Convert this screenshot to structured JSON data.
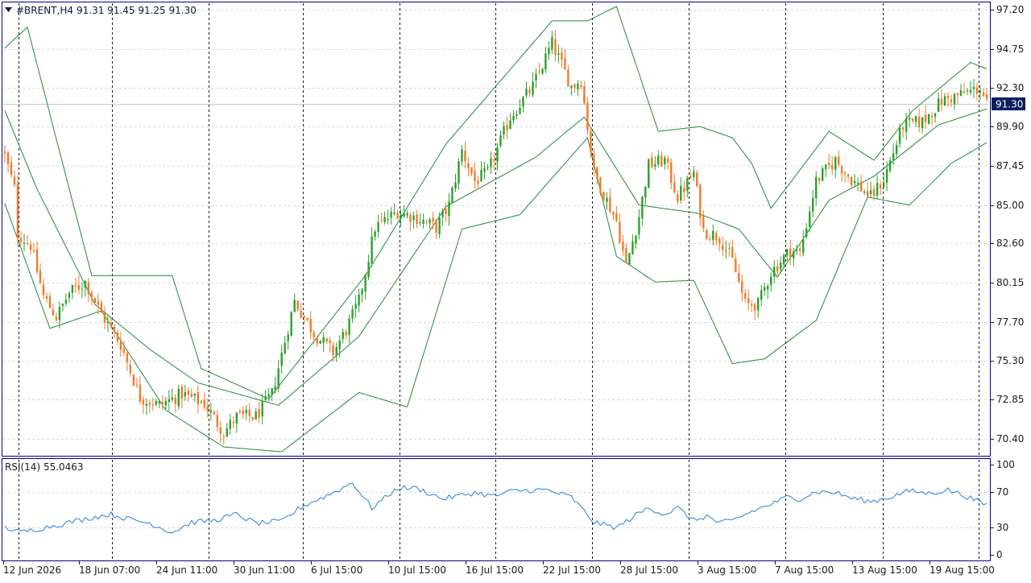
{
  "header": {
    "symbol": "#BRENT,H4",
    "ohlc": "91.31 91.45 91.25 91.30",
    "dropdown_icon": "triangle-down-icon"
  },
  "price_panel": {
    "current_price": "91.30",
    "y_ticks": [
      "97.20",
      "94.75",
      "92.30",
      "89.90",
      "87.45",
      "85.00",
      "82.60",
      "80.15",
      "77.70",
      "75.30",
      "72.85",
      "70.40"
    ],
    "y_range": [
      69.4,
      97.6
    ]
  },
  "rsi_panel": {
    "label": "RSI(14) 55.0463",
    "ticks": [
      "100",
      "70",
      "30",
      "0"
    ],
    "y_range": [
      0,
      100
    ]
  },
  "x_ticks": [
    "12 Jun 2026",
    "18 Jun 07:00",
    "24 Jun 11:00",
    "30 Jun 11:00",
    "6 Jul 15:00",
    "10 Jul 15:00",
    "16 Jul 15:00",
    "22 Jul 15:00",
    "28 Jul 15:00",
    "3 Aug 15:00",
    "7 Aug 15:00",
    "13 Aug 15:00",
    "19 Aug 15:00"
  ],
  "colors": {
    "bull": "#2ca02c",
    "bear": "#f07a2a",
    "band": "#1f8a3a",
    "rsi": "#2b7fd6",
    "frame": "#00008b",
    "price_badge_bg": "#0b1f5a",
    "grid": "#d9d9d9",
    "separator": "#1a1a1a"
  },
  "chart_data": {
    "type": "candlestick",
    "title": "#BRENT,H4",
    "close_anchors": [
      [
        0,
        88.1
      ],
      [
        3,
        86.0
      ],
      [
        4,
        83.2
      ],
      [
        8,
        82.5
      ],
      [
        12,
        79.3
      ],
      [
        16,
        78.0
      ],
      [
        20,
        79.5
      ],
      [
        25,
        80.2
      ],
      [
        30,
        78.2
      ],
      [
        36,
        76.3
      ],
      [
        42,
        73.0
      ],
      [
        48,
        72.5
      ],
      [
        55,
        73.2
      ],
      [
        62,
        72.6
      ],
      [
        68,
        70.8
      ],
      [
        72,
        71.8
      ],
      [
        78,
        71.8
      ],
      [
        83,
        73.2
      ],
      [
        90,
        79.0
      ],
      [
        96,
        77.0
      ],
      [
        102,
        75.8
      ],
      [
        106,
        77.2
      ],
      [
        110,
        79.0
      ],
      [
        115,
        83.6
      ],
      [
        122,
        84.6
      ],
      [
        128,
        84.2
      ],
      [
        134,
        83.6
      ],
      [
        138,
        85.0
      ],
      [
        142,
        88.4
      ],
      [
        146,
        86.5
      ],
      [
        150,
        87.0
      ],
      [
        157,
        90.5
      ],
      [
        164,
        92.4
      ],
      [
        170,
        95.1
      ],
      [
        176,
        92.4
      ],
      [
        179,
        92.8
      ],
      [
        183,
        87.0
      ],
      [
        190,
        84.0
      ],
      [
        193,
        81.2
      ],
      [
        197,
        84.3
      ],
      [
        200,
        87.5
      ],
      [
        205,
        87.8
      ],
      [
        209,
        85.5
      ],
      [
        214,
        87.0
      ],
      [
        217,
        83.4
      ],
      [
        222,
        83.0
      ],
      [
        226,
        81.5
      ],
      [
        230,
        78.8
      ],
      [
        234,
        78.8
      ],
      [
        238,
        80.8
      ],
      [
        244,
        82.2
      ],
      [
        247,
        82.0
      ],
      [
        252,
        86.5
      ],
      [
        258,
        87.8
      ],
      [
        263,
        86.6
      ],
      [
        269,
        85.5
      ],
      [
        273,
        86.6
      ],
      [
        279,
        90.0
      ],
      [
        285,
        90.2
      ],
      [
        291,
        91.5
      ],
      [
        297,
        91.9
      ],
      [
        303,
        92.3
      ],
      [
        305,
        91.3
      ]
    ],
    "bollinger": {
      "upper": [
        [
          0,
          94.8
        ],
        [
          7,
          96.1
        ],
        [
          27,
          80.6
        ],
        [
          52,
          80.6
        ],
        [
          61,
          74.8
        ],
        [
          82,
          72.9
        ],
        [
          112,
          80.6
        ],
        [
          137,
          88.8
        ],
        [
          170,
          96.5
        ],
        [
          181,
          96.5
        ],
        [
          190,
          97.4
        ],
        [
          203,
          89.6
        ],
        [
          216,
          89.9
        ],
        [
          226,
          89.2
        ],
        [
          232,
          87.6
        ],
        [
          238,
          84.8
        ],
        [
          256,
          89.6
        ],
        [
          270,
          87.8
        ],
        [
          282,
          90.9
        ],
        [
          300,
          93.9
        ],
        [
          305,
          93.5
        ]
      ],
      "middle": [
        [
          0,
          90.9
        ],
        [
          10,
          86.0
        ],
        [
          28,
          78.8
        ],
        [
          45,
          76.0
        ],
        [
          60,
          73.9
        ],
        [
          85,
          72.5
        ],
        [
          110,
          76.8
        ],
        [
          137,
          84.9
        ],
        [
          165,
          88.0
        ],
        [
          180,
          90.5
        ],
        [
          197,
          85.0
        ],
        [
          215,
          84.5
        ],
        [
          228,
          83.5
        ],
        [
          240,
          80.5
        ],
        [
          256,
          85.3
        ],
        [
          270,
          86.8
        ],
        [
          290,
          90.0
        ],
        [
          305,
          91.0
        ]
      ],
      "lower": [
        [
          0,
          85.1
        ],
        [
          14,
          77.3
        ],
        [
          30,
          78.4
        ],
        [
          50,
          72.2
        ],
        [
          68,
          69.9
        ],
        [
          86,
          69.6
        ],
        [
          110,
          73.3
        ],
        [
          125,
          72.4
        ],
        [
          142,
          83.5
        ],
        [
          160,
          84.4
        ],
        [
          181,
          89.2
        ],
        [
          190,
          81.8
        ],
        [
          202,
          80.2
        ],
        [
          214,
          80.3
        ],
        [
          226,
          75.1
        ],
        [
          236,
          75.4
        ],
        [
          252,
          77.8
        ],
        [
          268,
          85.5
        ],
        [
          281,
          85.0
        ],
        [
          294,
          87.6
        ],
        [
          305,
          88.9
        ]
      ]
    },
    "rsi": {
      "anchors": [
        [
          0,
          30.5
        ],
        [
          5,
          25
        ],
        [
          12,
          30
        ],
        [
          20,
          36
        ],
        [
          28,
          42
        ],
        [
          33,
          45
        ],
        [
          38,
          40
        ],
        [
          45,
          35
        ],
        [
          52,
          25
        ],
        [
          58,
          36
        ],
        [
          65,
          38
        ],
        [
          72,
          45
        ],
        [
          78,
          35
        ],
        [
          86,
          37
        ],
        [
          92,
          53
        ],
        [
          102,
          69
        ],
        [
          108,
          80
        ],
        [
          114,
          52
        ],
        [
          122,
          74
        ],
        [
          128,
          74
        ],
        [
          136,
          62
        ],
        [
          146,
          69
        ],
        [
          152,
          65
        ],
        [
          158,
          71
        ],
        [
          168,
          72
        ],
        [
          176,
          64
        ],
        [
          183,
          36
        ],
        [
          190,
          30
        ],
        [
          196,
          44
        ],
        [
          200,
          52
        ],
        [
          205,
          45
        ],
        [
          209,
          52
        ],
        [
          214,
          38
        ],
        [
          218,
          43
        ],
        [
          222,
          35
        ],
        [
          226,
          38
        ],
        [
          232,
          48
        ],
        [
          238,
          56
        ],
        [
          243,
          64
        ],
        [
          247,
          62
        ],
        [
          252,
          70
        ],
        [
          258,
          69
        ],
        [
          263,
          63
        ],
        [
          269,
          59
        ],
        [
          275,
          64
        ],
        [
          281,
          71
        ],
        [
          287,
          68
        ],
        [
          293,
          72
        ],
        [
          298,
          66
        ],
        [
          305,
          55
        ]
      ],
      "levels": [
        70,
        30
      ]
    },
    "n_bars": 306,
    "ylim": [
      69.4,
      97.6
    ]
  }
}
